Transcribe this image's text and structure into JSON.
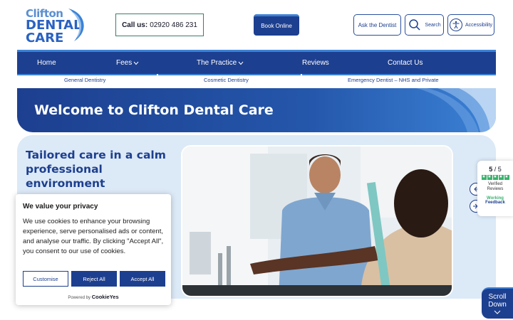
{
  "header": {
    "logo": {
      "line1": "Clifton",
      "line2": "DENTAL",
      "line3": "CARE"
    },
    "call_label": "Call us:",
    "call_number": "02920 486 231",
    "book_label": "Book Online",
    "ask_label": "Ask the Dentist",
    "search_label": "Search",
    "accessibility_label": "Accessibility"
  },
  "nav": {
    "items": [
      {
        "label": "Home"
      },
      {
        "label": "Fees"
      },
      {
        "label": "The Practice"
      },
      {
        "label": "Reviews"
      },
      {
        "label": "Contact Us"
      }
    ],
    "sub": [
      {
        "label": "General Dentistry"
      },
      {
        "label": "Cosmetic Dentistry"
      },
      {
        "label": "Emergency Dentist – NHS and Private"
      }
    ]
  },
  "hero": {
    "title": "Welcome to Clifton Dental Care"
  },
  "main": {
    "tagline": "Tailored care in a calm professional environment"
  },
  "reviews": {
    "score": "5",
    "score_of": "/ 5",
    "line1": "Verified",
    "line2": "Reviews",
    "brand1": "Working",
    "brand2": "Feedback",
    "star_color": "#38b26c"
  },
  "scroll": {
    "line1": "Scroll",
    "line2": "Down"
  },
  "cookie": {
    "title": "We value your privacy",
    "body": "We use cookies to enhance your browsing experience, serve personalised ads or content, and analyse our traffic. By clicking \"Accept All\", you consent to our use of cookies.",
    "customise": "Customise",
    "reject": "Reject All",
    "accept": "Accept All",
    "powered": "Powered by",
    "brand": "CookieYes"
  },
  "colors": {
    "primary": "#1d3f8f",
    "accent": "#3b82d6",
    "panel": "#dce9f7"
  }
}
